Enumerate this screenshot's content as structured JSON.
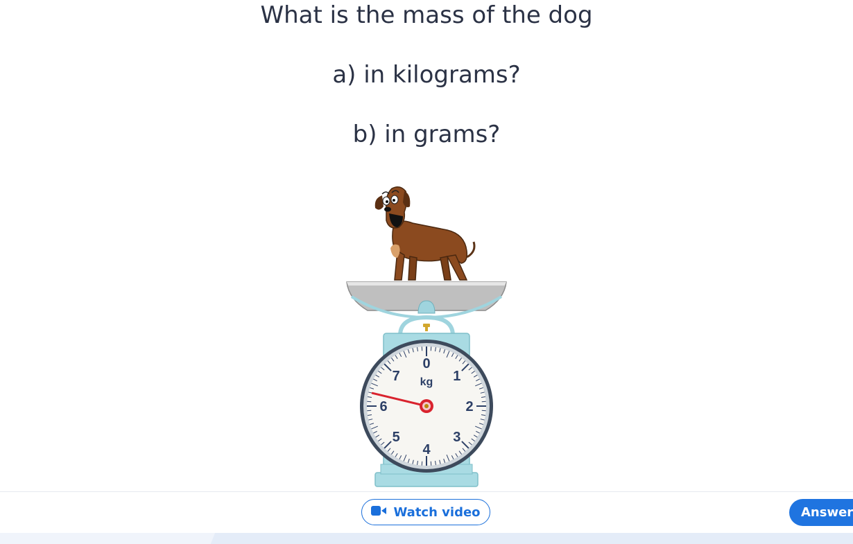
{
  "question": {
    "main": "What is the mass of the dog",
    "part_a": "a) in kilograms?",
    "part_b": "b) in grams?"
  },
  "scale": {
    "unit_label": "kg",
    "dial_numbers": [
      "0",
      "1",
      "2",
      "3",
      "4",
      "5",
      "6",
      "7"
    ],
    "pointer_reading_kg": 6.3,
    "colors": {
      "body": "#a9dbe3",
      "pointer": "#d9232e",
      "pan": "#c8c8c8"
    }
  },
  "footer": {
    "watch_video_label": "Watch video",
    "watch_video_icon": "video-camera-icon",
    "answer_label": "Answer",
    "accent": "#1f74e0"
  }
}
